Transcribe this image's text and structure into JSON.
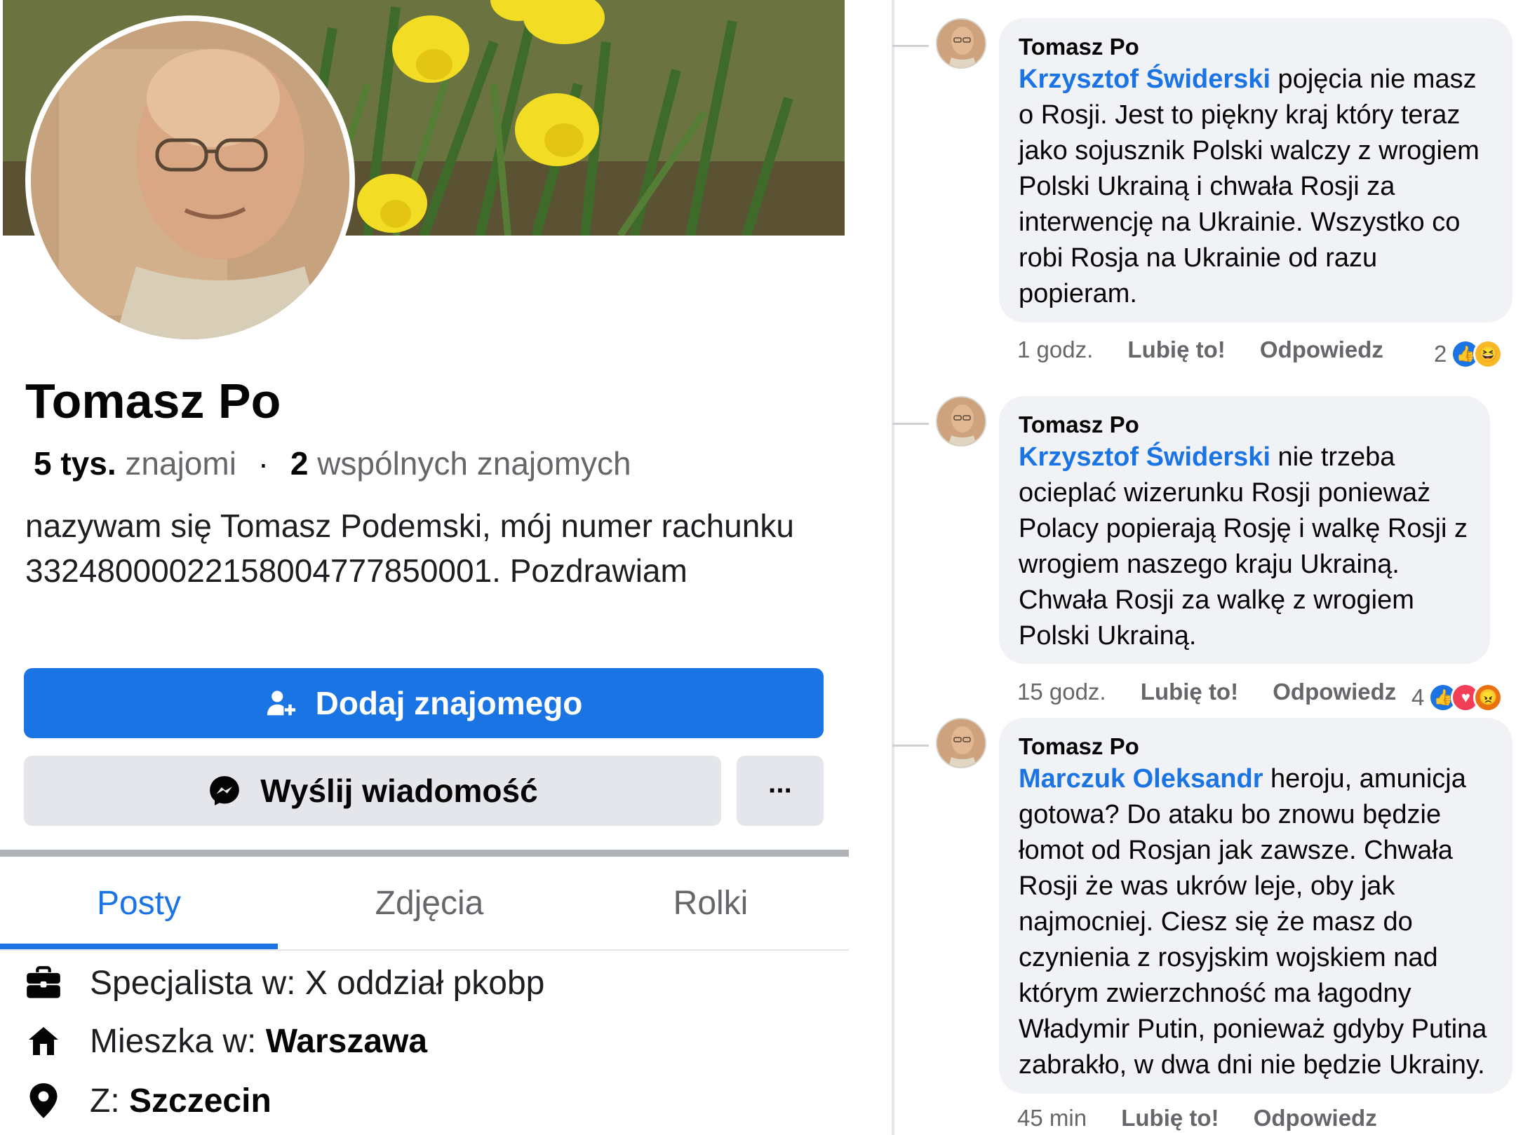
{
  "profile": {
    "name": "Tomasz Po",
    "friends_count": "5 tys.",
    "friends_label": "znajomi",
    "mutual_count": "2",
    "mutual_label": "wspólnych znajomych",
    "bio": "nazywam się Tomasz Podemski, mój numer rachunku 33248000022158004777850001. Pozdrawiam"
  },
  "actions": {
    "add_friend": "Dodaj znajomego",
    "send_message": "Wyślij wiadomość",
    "more": "···"
  },
  "tabs": [
    {
      "label": "Posty",
      "active": true
    },
    {
      "label": "Zdjęcia",
      "active": false
    },
    {
      "label": "Rolki",
      "active": false
    }
  ],
  "details": [
    {
      "icon": "briefcase-icon",
      "prefix": "Specjalista w: X oddział pkobp",
      "value": ""
    },
    {
      "icon": "home-icon",
      "prefix": "Mieszka w: ",
      "value": "Warszawa"
    },
    {
      "icon": "location-pin-icon",
      "prefix": "Z: ",
      "value": "Szczecin"
    }
  ],
  "comments": [
    {
      "author": "Tomasz Po",
      "mention": "Krzysztof Świderski",
      "lines": [
        " pojęcia nie masz",
        "o Rosji. Jest to piękny kraj który teraz",
        "jako sojusznik Polski walczy z wrogiem",
        "Polski Ukrainą i chwała Rosji za",
        "interwencję na Ukrainie. Wszystko co",
        "robi Rosja na Ukrainie od razu",
        "popieram."
      ],
      "time": "1 godz.",
      "like": "Lubię to!",
      "reply": "Odpowiedz",
      "reaction_count": "2",
      "reactions": [
        "like",
        "haha"
      ]
    },
    {
      "author": "Tomasz Po",
      "mention": "Krzysztof Świderski",
      "lines": [
        " nie trzeba",
        "ocieplać wizerunku Rosji ponieważ",
        "Polacy popierają Rosję i walkę Rosji z",
        "wrogiem naszego kraju Ukrainą.",
        "Chwała Rosji za walkę z wrogiem",
        "Polski Ukrainą."
      ],
      "time": "15 godz.",
      "like": "Lubię to!",
      "reply": "Odpowiedz",
      "reaction_count": "4",
      "reactions": [
        "like",
        "love",
        "angry"
      ]
    },
    {
      "author": "Tomasz Po",
      "mention": "Marczuk Oleksandr",
      "lines": [
        " heroju, amunicja",
        "gotowa? Do ataku bo znowu będzie",
        "łomot od Rosjan jak zawsze. Chwała",
        "Rosji że was ukrów leje, oby jak",
        "najmocniej. Ciesz się że masz do",
        "czynienia z rosyjskim wojskiem nad",
        "którym zwierzchność ma łagodny",
        "Władymir Putin, ponieważ gdyby Putina",
        "zabrakło, w dwa dni nie będzie Ukrainy."
      ],
      "time": "45 min",
      "like": "Lubię to!",
      "reply": "Odpowiedz",
      "reaction_count": "",
      "reactions": []
    }
  ],
  "colors": {
    "accent": "#1b74e4",
    "bubble": "#f0f2f5",
    "secondary_text": "#65676b"
  }
}
